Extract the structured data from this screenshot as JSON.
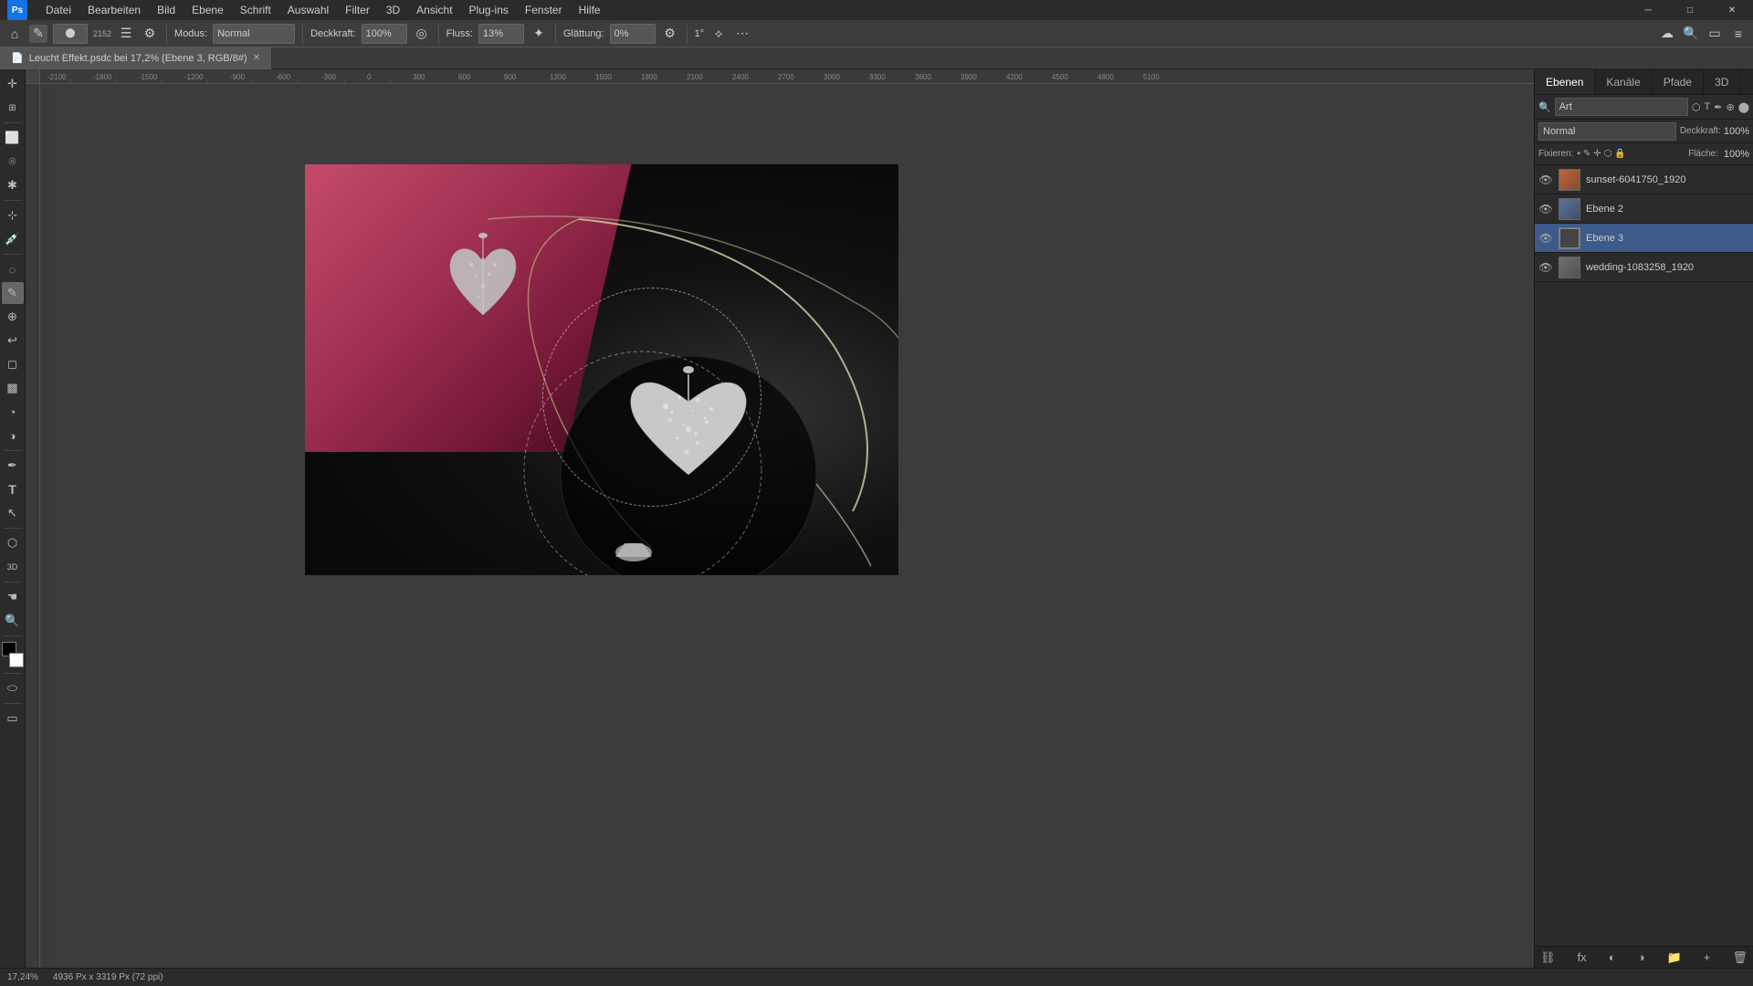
{
  "app": {
    "name": "Adobe Photoshop",
    "title_bar": {
      "minimize": "─",
      "maximize": "□",
      "close": "✕"
    }
  },
  "menu": {
    "items": [
      "Datei",
      "Bearbeiten",
      "Bild",
      "Ebene",
      "Schrift",
      "Auswahl",
      "Filter",
      "3D",
      "Ansicht",
      "Plug-ins",
      "Fenster",
      "Hilfe"
    ]
  },
  "options_bar": {
    "brush_icon": "✎",
    "mode_label": "Modus:",
    "mode_value": "Normal",
    "opacity_label": "Deckkraft:",
    "opacity_value": "100%",
    "flow_label": "Fluss:",
    "flow_value": "13%",
    "smoothing_label": "Glättung:",
    "smoothing_value": "0%",
    "pressure_label": "1°"
  },
  "document": {
    "tab_name": "Leucht Effekt.psdc bei 17,2% (Ebene 3, RGB/8#)",
    "zoom": "17,24%",
    "dimensions": "4936 Px x 3319 Px (72 ppi)"
  },
  "layers_panel": {
    "tabs": [
      "Ebenen",
      "Kanäle",
      "Pfade",
      "3D"
    ],
    "active_tab": "Ebenen",
    "art_label": "Art",
    "blend_mode": "Normal",
    "opacity_label": "Deckkraft:",
    "opacity_value": "100%",
    "fill_label": "Fläche:",
    "fill_value": "100%",
    "lock_label": "Fixieren:",
    "layers": [
      {
        "id": "sunset",
        "name": "sunset-6041750_1920",
        "visible": true,
        "thumb_class": "thumb-sunset",
        "active": false
      },
      {
        "id": "ebene2",
        "name": "Ebene 2",
        "visible": true,
        "thumb_class": "thumb-ebene2",
        "active": false
      },
      {
        "id": "ebene3",
        "name": "Ebene 3",
        "visible": true,
        "thumb_class": "thumb-ebene3",
        "active": true
      },
      {
        "id": "wedding",
        "name": "wedding-1083258_1920",
        "visible": true,
        "thumb_class": "thumb-wedding",
        "active": false
      }
    ],
    "bottom_icons": [
      "fx",
      "⬡",
      "◐",
      "🔒",
      "📁",
      "🗑"
    ]
  },
  "status_bar": {
    "zoom": "17,24%",
    "dimensions": "4936 Px x 3319 Px (72 ppi)"
  },
  "ruler": {
    "unit": "px",
    "marks": [
      "-2100",
      "-1800",
      "-1500",
      "-1200",
      "-900",
      "-600",
      "-300",
      "0",
      "300",
      "600",
      "900",
      "1200",
      "1500",
      "1800",
      "2100",
      "2400",
      "2700",
      "3000",
      "3300",
      "3600",
      "3900",
      "4200",
      "4500",
      "4800",
      "5100"
    ]
  }
}
